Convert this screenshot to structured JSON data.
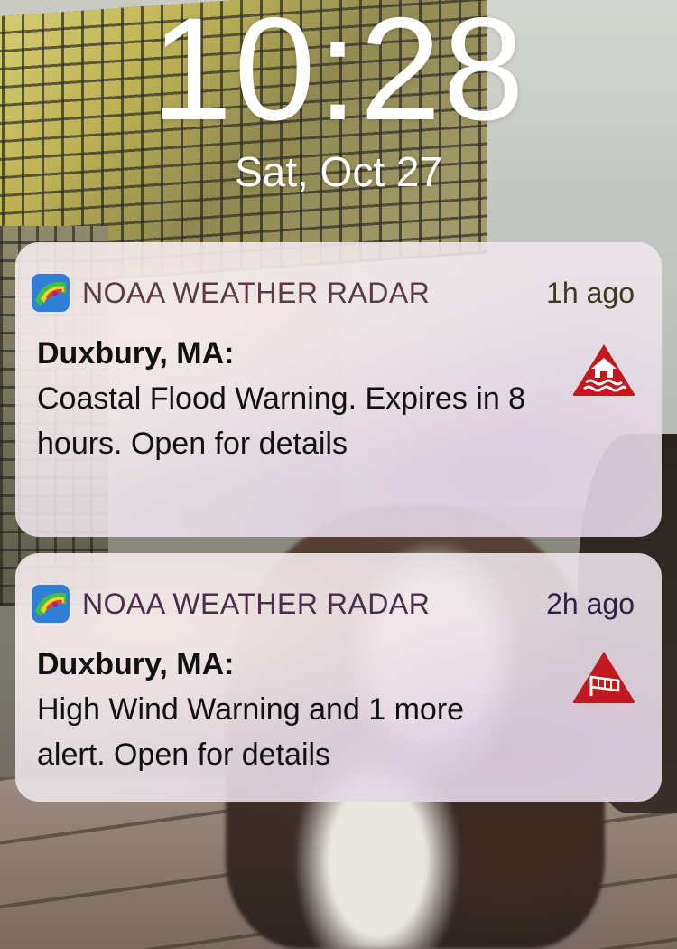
{
  "lockscreen": {
    "time": "10:28",
    "date": "Sat, Oct 27"
  },
  "notifications": [
    {
      "app_name": "NOAA WEATHER RADAR",
      "time_ago": "1h ago",
      "title": "Duxbury, MA:",
      "body": "Coastal Flood Warning. Expires in 8 hours. Open for details",
      "alert_icon": "coastal-flood-icon"
    },
    {
      "app_name": "NOAA WEATHER RADAR",
      "time_ago": "2h ago",
      "title": "Duxbury, MA:",
      "body": "High Wind Warning and 1 more alert. Open for details",
      "alert_icon": "windsock-icon"
    }
  ],
  "colors": {
    "alert_red": "#c0191f",
    "text": "#111111",
    "clock": "#ffffff"
  }
}
